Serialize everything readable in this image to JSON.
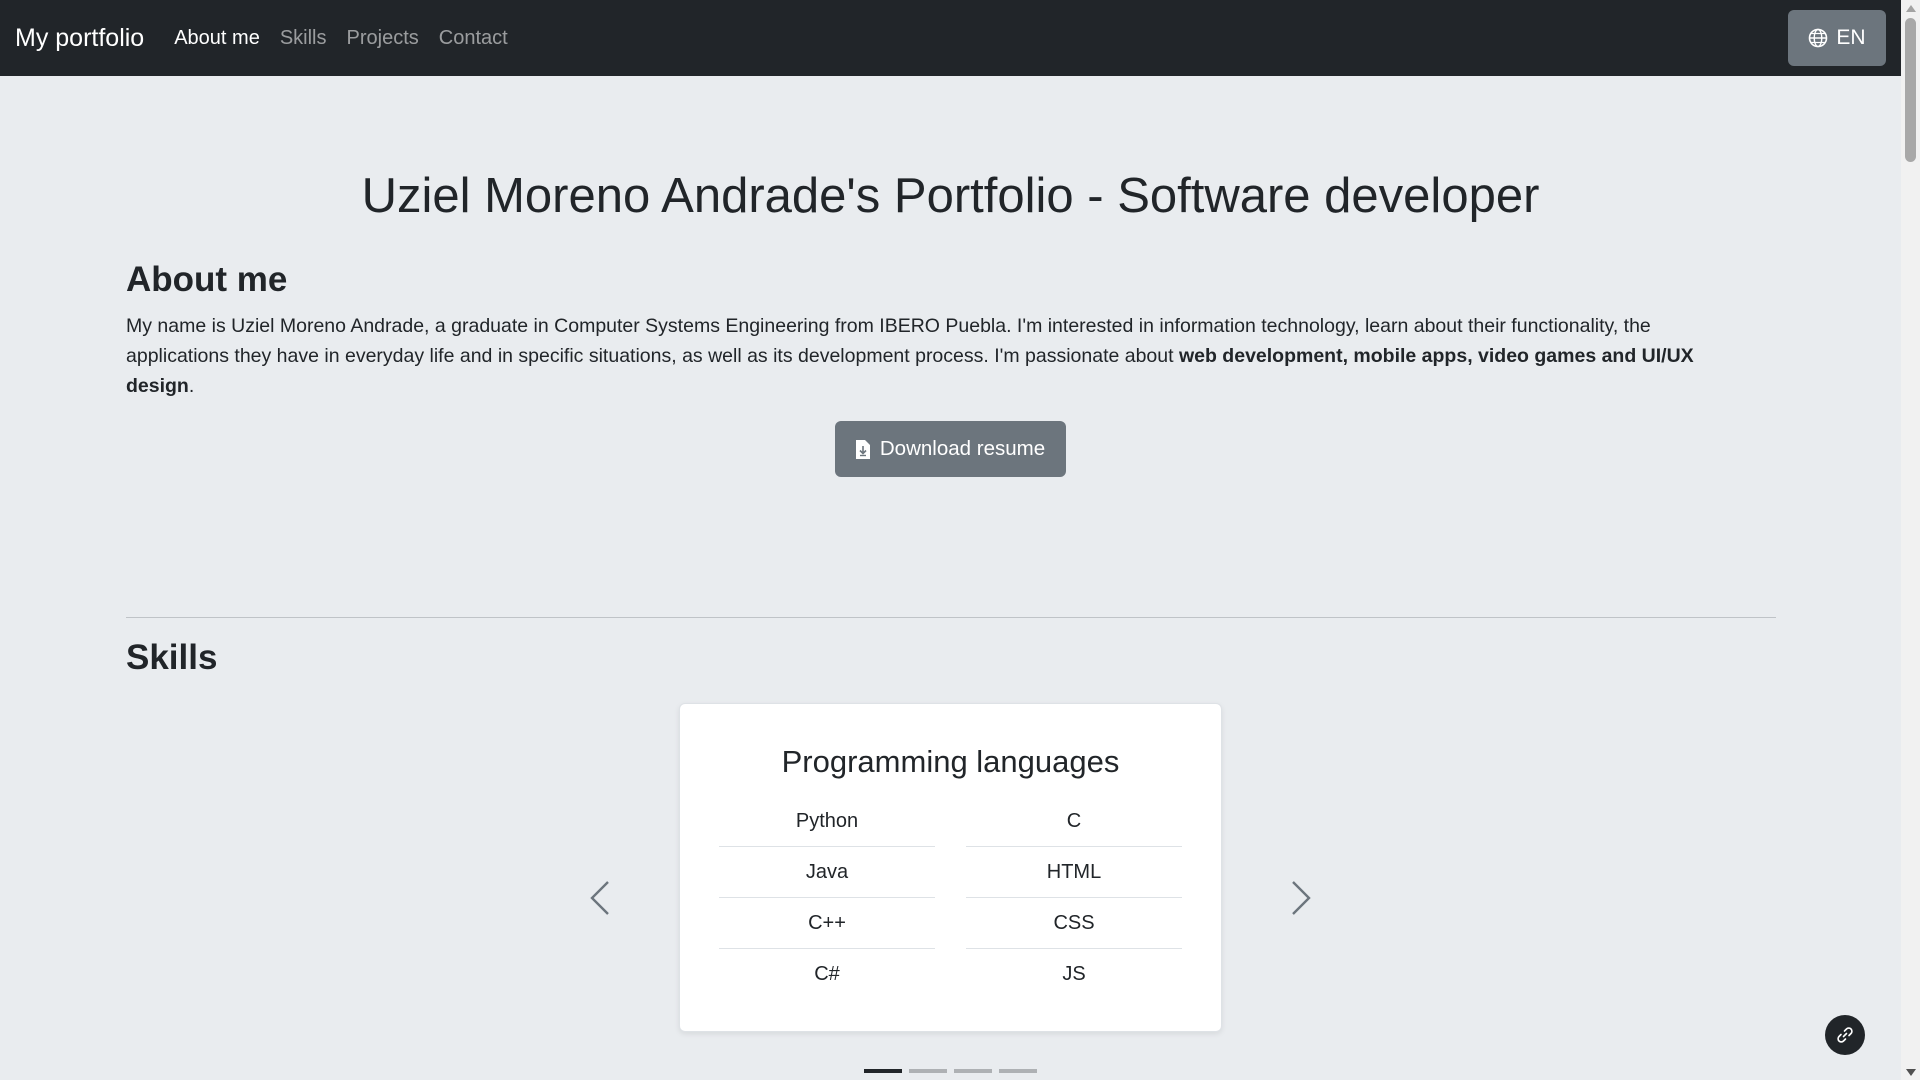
{
  "navbar": {
    "brand": "My portfolio",
    "links": [
      "About me",
      "Skills",
      "Projects",
      "Contact"
    ],
    "active_link": "About me",
    "language_button": {
      "icon": "globe-icon",
      "label": "EN"
    }
  },
  "main": {
    "title": "Uziel Moreno Andrade's Portfolio - Software developer",
    "about": {
      "heading": "About me",
      "text_part1": "My name is Uziel Moreno Andrade, a graduate in Computer Systems Engineering from IBERO Puebla. I'm interested in information technology, learn about their functionality, the applications they have in everyday life and in specific situations, as well as its development process. I'm passionate about ",
      "text_bold": "web development, mobile apps, video games and UI/UX design",
      "text_end": ".",
      "download_button": {
        "icon": "file-download-icon",
        "label": "Download resume"
      }
    },
    "skills": {
      "heading": "Skills",
      "card": {
        "title": "Programming languages",
        "left_column": [
          "Python",
          "Java",
          "C++",
          "C#"
        ],
        "right_column": [
          "C",
          "HTML",
          "CSS",
          "JS"
        ]
      },
      "prev_icon": "chevron-left-icon",
      "next_icon": "chevron-right-icon",
      "slide_count": 4,
      "active_slide": 1
    }
  },
  "floating_button": {
    "icon": "link-icon"
  },
  "colors": {
    "navbar_bg": "#212529",
    "page_bg": "#e9ecef",
    "button_bg": "#6c757d",
    "card_bg": "#ffffff"
  }
}
